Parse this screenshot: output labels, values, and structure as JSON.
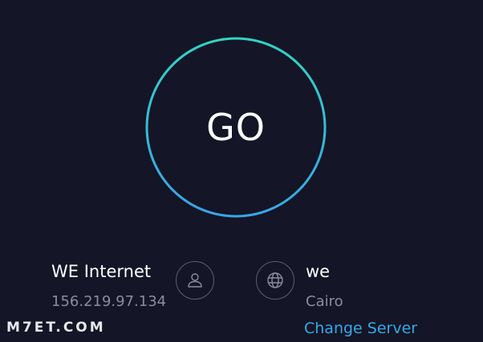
{
  "go_button": {
    "label": "GO",
    "ring_gradient": [
      "#2fd6c4",
      "#3aa4e6"
    ]
  },
  "isp": {
    "name": "WE Internet",
    "ip": "156.219.97.134",
    "icon": "user-icon"
  },
  "server": {
    "name": "we",
    "location": "Cairo",
    "change_label": "Change Server",
    "icon": "globe-icon"
  },
  "watermark": {
    "text": "M7ET.COM"
  },
  "colors": {
    "background": "#141526",
    "accent": "#35a9e8",
    "muted_text": "#8b8d9e"
  }
}
